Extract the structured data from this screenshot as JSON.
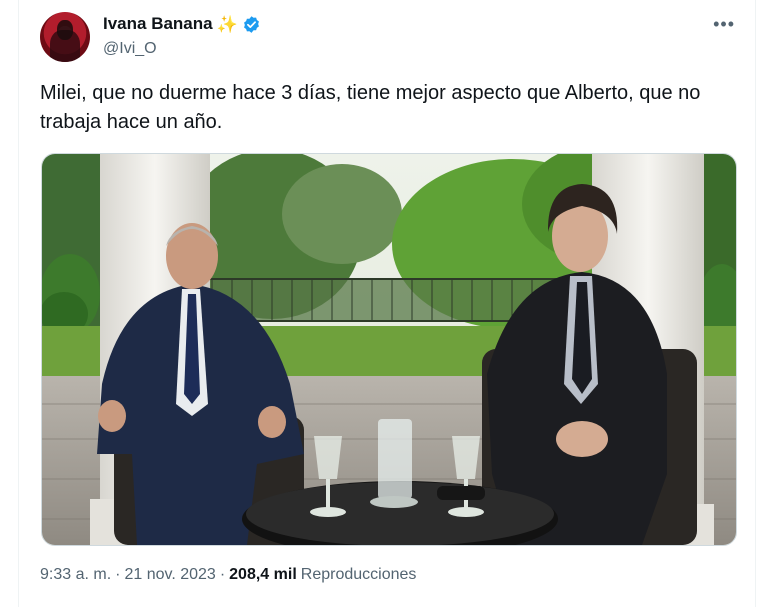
{
  "author": {
    "display_name": "Ivana Banana",
    "handle": "@Ivi_O",
    "badge_icon": "sparkles-icon",
    "verified": true,
    "verified_color": "#1d9bf0"
  },
  "tweet": {
    "text": "Milei, que no duerme hace 3 días, tiene mejor aspecto que Alberto, que no trabaja hace un año."
  },
  "meta": {
    "time": "9:33 a. m.",
    "separator": "·",
    "date": "21 nov. 2023",
    "separator2": "·",
    "views_count": "208,4 mil",
    "views_label": "Reproducciones"
  },
  "more_label": "•••",
  "colors": {
    "text": "#0f1419",
    "secondary": "#536471",
    "accent": "#1d9bf0"
  }
}
